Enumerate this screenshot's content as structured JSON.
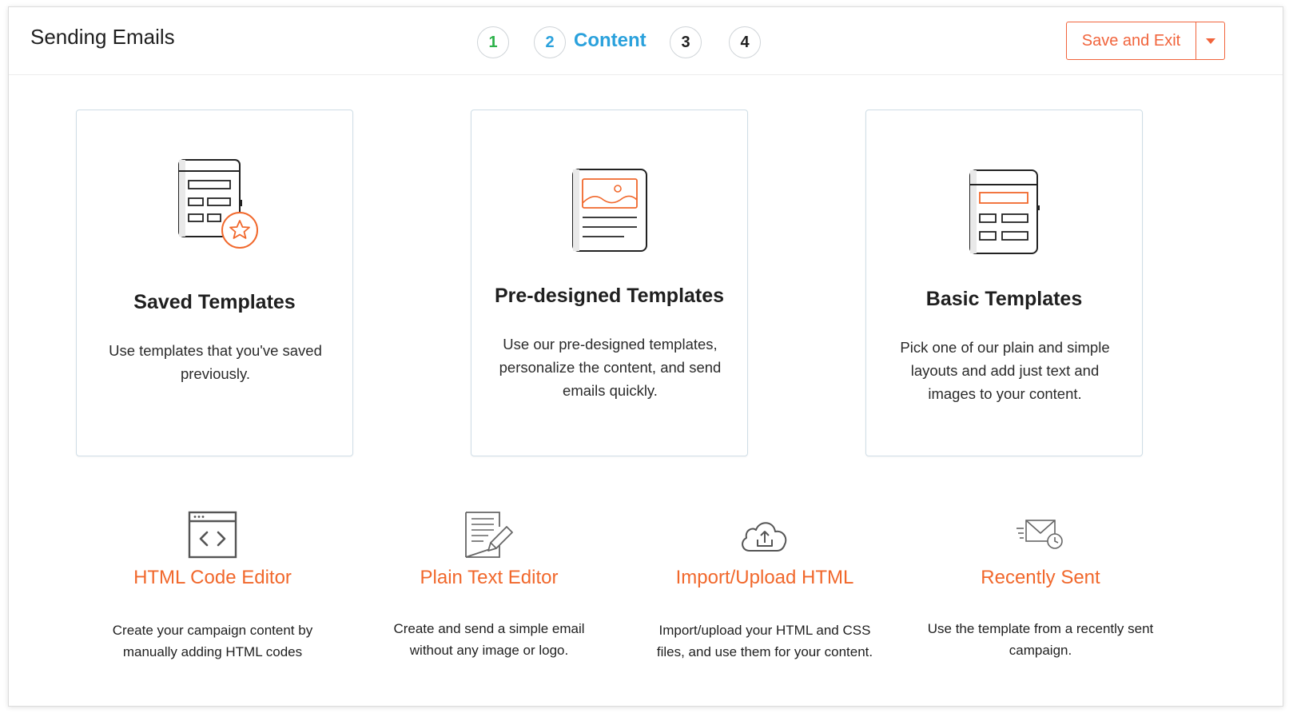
{
  "header": {
    "title": "Sending Emails",
    "steps": [
      {
        "number": "1",
        "color": "#2db24a"
      },
      {
        "number": "2",
        "label": "Content",
        "color": "#2aa1dc"
      },
      {
        "number": "3",
        "color": "#1f1f1f"
      },
      {
        "number": "4",
        "color": "#1f1f1f"
      }
    ],
    "save_label": "Save and Exit",
    "accent_color": "#f1643c"
  },
  "cards": [
    {
      "icon": "saved-template-icon",
      "title": "Saved Templates",
      "description": "Use templates that you've saved previously."
    },
    {
      "icon": "pre-designed-template-icon",
      "title": "Pre-designed Templates",
      "description": "Use our pre-designed templates, personalize the content, and send emails quickly."
    },
    {
      "icon": "basic-template-icon",
      "title": "Basic Templates",
      "description": "Pick one of our plain and simple layouts and add just text and images to your content."
    }
  ],
  "options": [
    {
      "icon": "code-editor-icon",
      "title": "HTML Code Editor",
      "description": "Create your campaign content by manually adding HTML codes"
    },
    {
      "icon": "text-editor-icon",
      "title": "Plain Text Editor",
      "description": "Create and send a simple email without any image or logo."
    },
    {
      "icon": "cloud-upload-icon",
      "title": "Import/Upload HTML",
      "description": "Import/upload your HTML and CSS files, and use them for your content."
    },
    {
      "icon": "recently-sent-icon",
      "title": "Recently Sent",
      "description": "Use the template from a recently sent campaign."
    }
  ]
}
